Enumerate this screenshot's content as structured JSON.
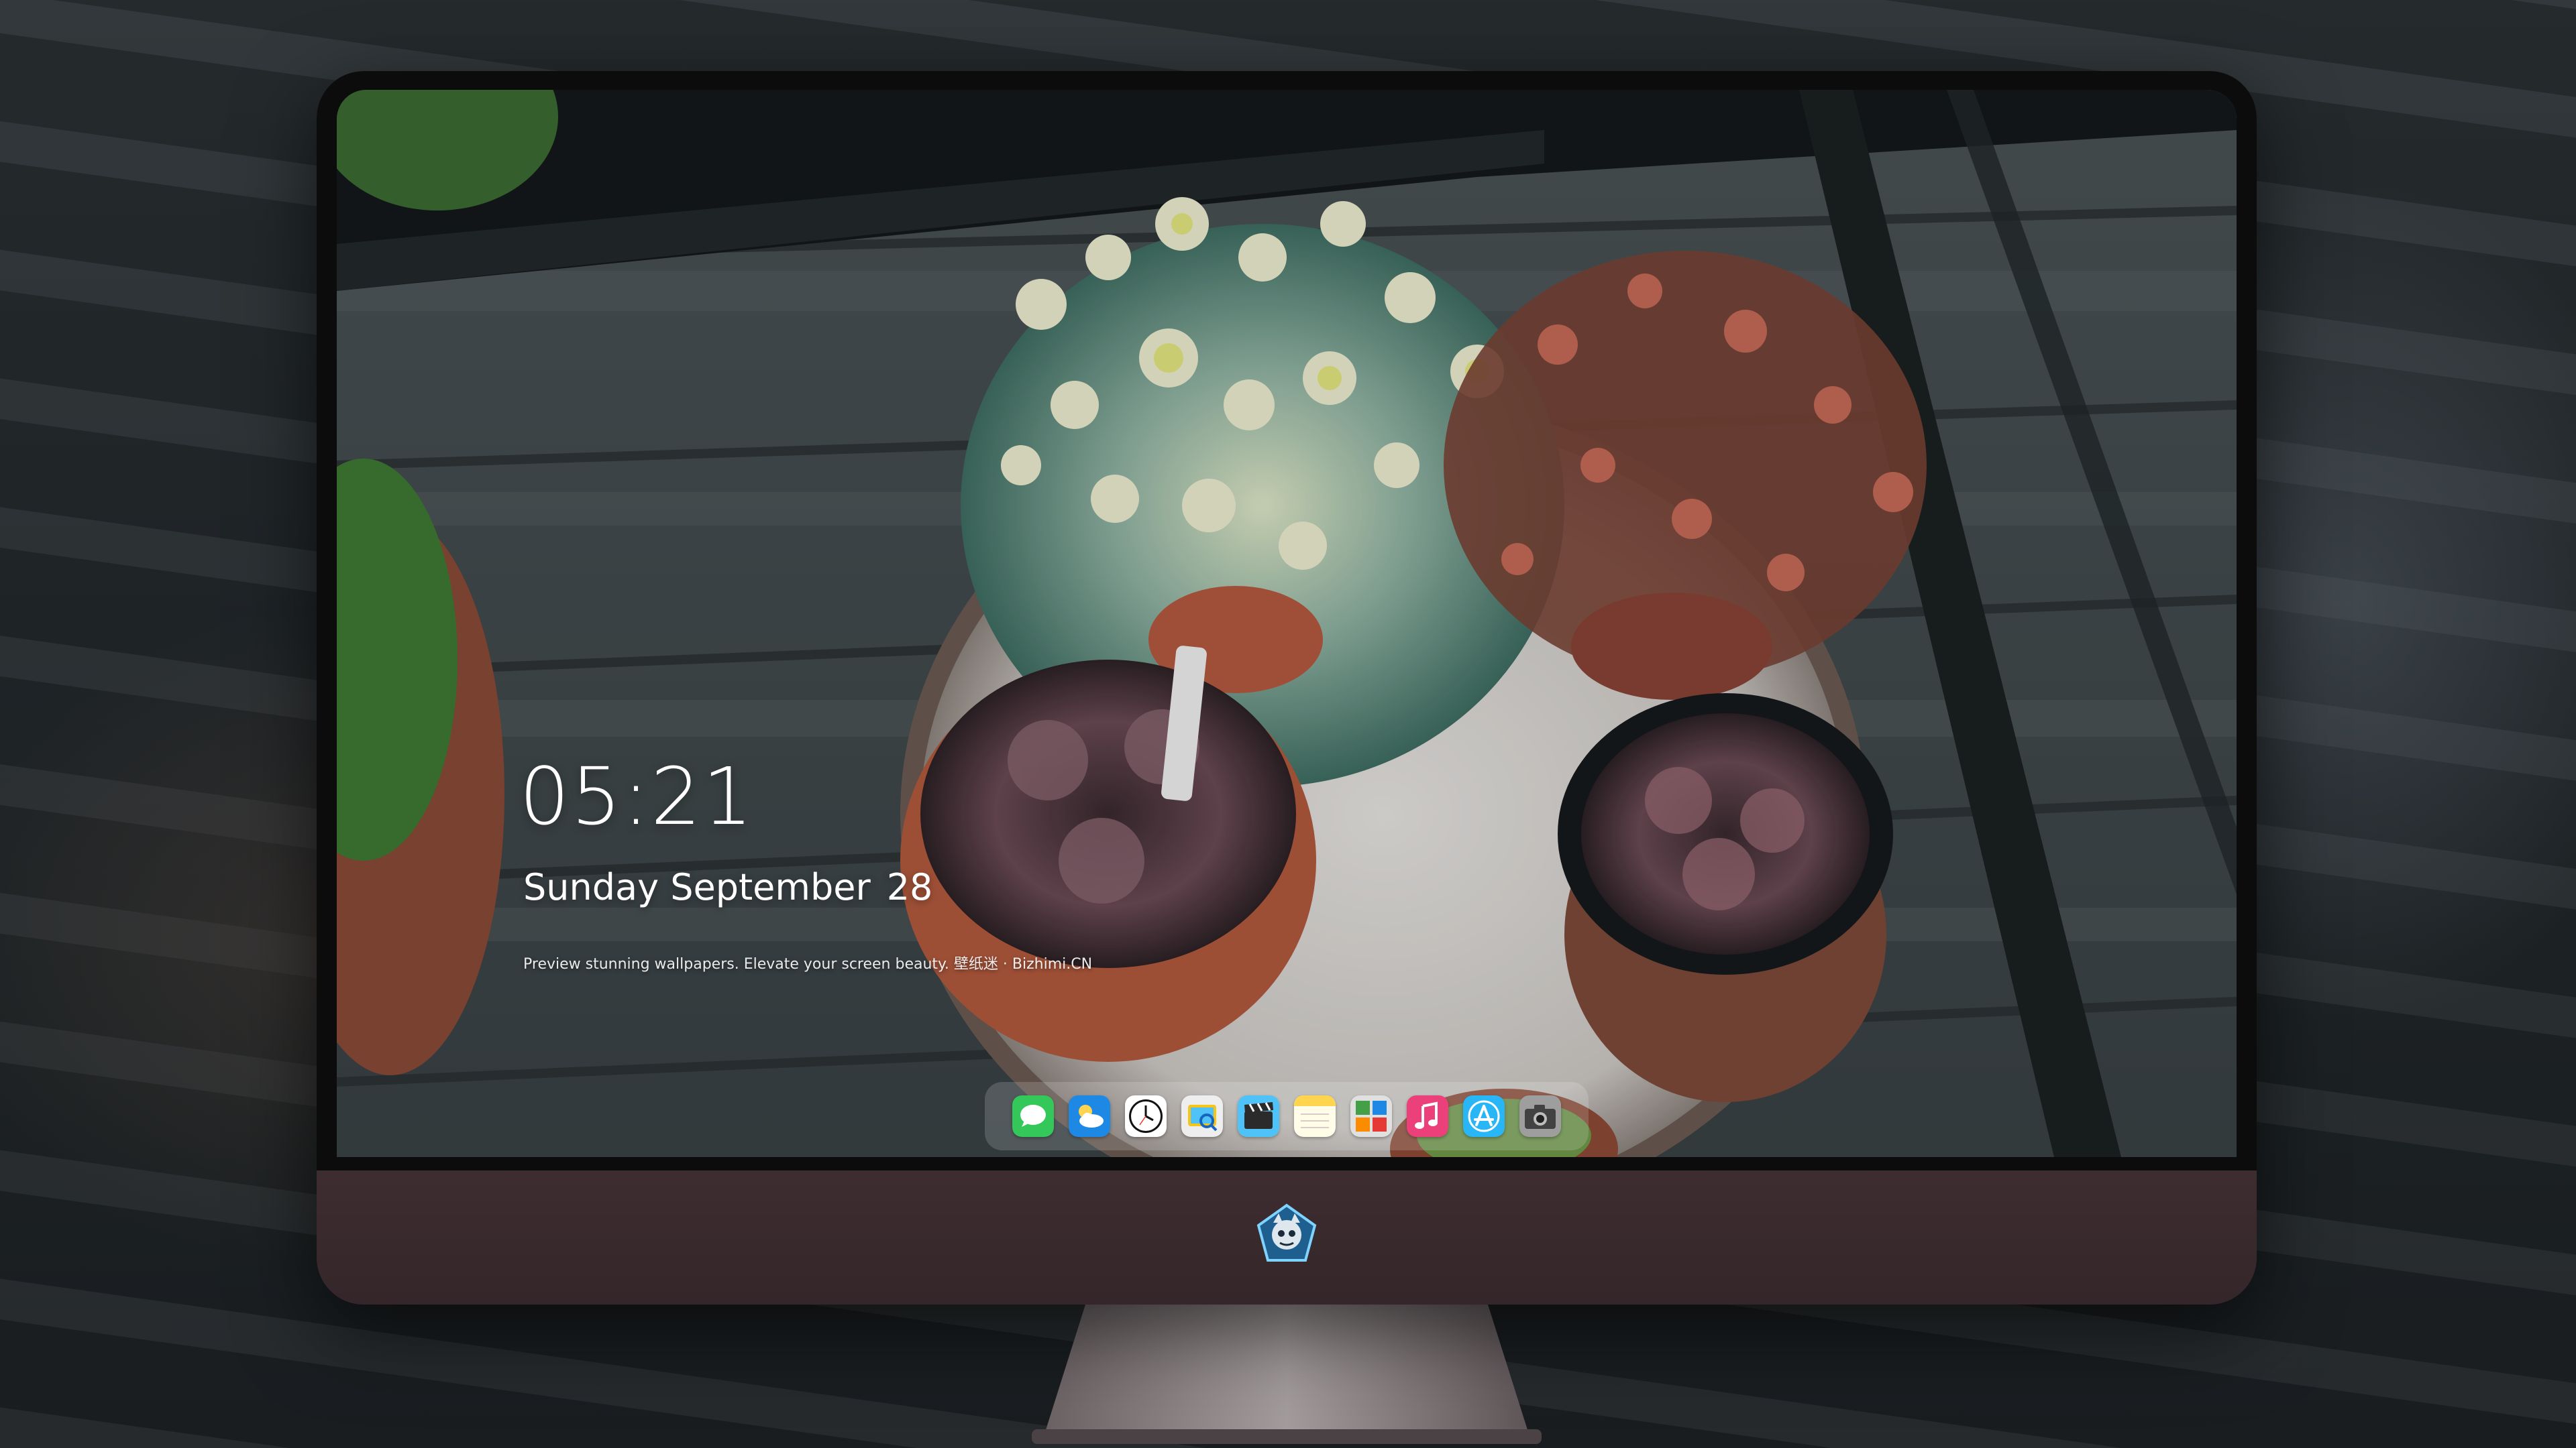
{
  "lockscreen": {
    "time": "05:21",
    "day": "Sunday September",
    "date_number": "28",
    "tagline": "Preview stunning wallpapers. Elevate your screen beauty. 壁纸迷 · Bizhimi.CN"
  },
  "dock": {
    "items": [
      {
        "name": "messages",
        "icon": "chat-bubble-icon",
        "color": "#34c759"
      },
      {
        "name": "weather",
        "icon": "cloud-sun-icon",
        "color": "#1e88e5"
      },
      {
        "name": "clock",
        "icon": "clock-icon",
        "color": "#ffffff"
      },
      {
        "name": "preview",
        "icon": "image-viewer-icon",
        "color": "#f5c518"
      },
      {
        "name": "video",
        "icon": "clapper-icon",
        "color": "#4fc3f7"
      },
      {
        "name": "notes",
        "icon": "notes-icon",
        "color": "#ffd54f"
      },
      {
        "name": "photo-booth",
        "icon": "photo-booth-icon",
        "color": "#43a047"
      },
      {
        "name": "music",
        "icon": "music-note-icon",
        "color": "#ec407a"
      },
      {
        "name": "app-store",
        "icon": "app-store-icon",
        "color": "#29b6f6"
      },
      {
        "name": "camera",
        "icon": "camera-icon",
        "color": "#616161"
      }
    ]
  },
  "colors": {
    "monitor_chin": "#3b2a2c",
    "bezel": "#0c0c0d"
  }
}
